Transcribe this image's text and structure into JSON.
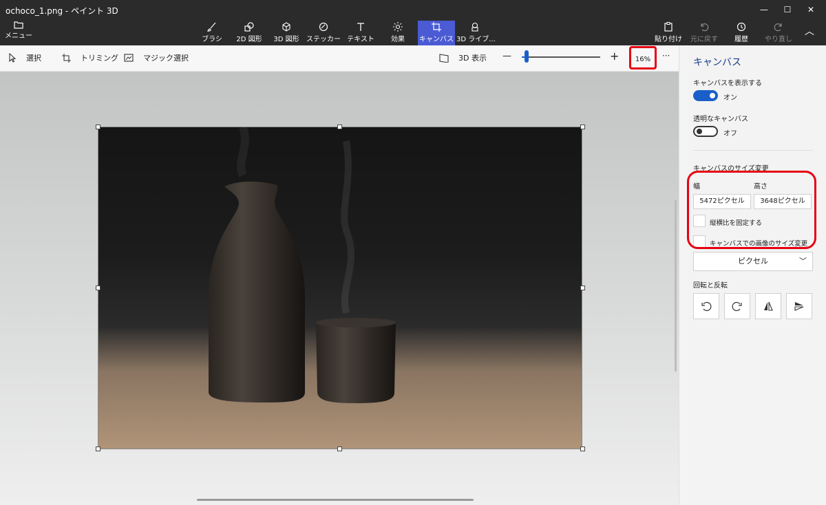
{
  "window": {
    "title": "ochoco_1.png - ペイント 3D"
  },
  "ribbon": {
    "menu_label": "メニュー",
    "tools": [
      {
        "label": "ブラシ"
      },
      {
        "label": "2D 図形"
      },
      {
        "label": "3D 図形"
      },
      {
        "label": "ステッカー"
      },
      {
        "label": "テキスト"
      },
      {
        "label": "効果"
      },
      {
        "label": "キャンバス"
      },
      {
        "label": "3D ライブ..."
      }
    ],
    "right_tools": [
      {
        "label": "貼り付け"
      },
      {
        "label": "元に戻す"
      },
      {
        "label": "履歴"
      },
      {
        "label": "やり直し"
      }
    ]
  },
  "toolbar": {
    "select": "選択",
    "crop": "トリミング",
    "magic_select": "マジック選択",
    "view_3d": "3D 表示",
    "zoom_percent": "16%",
    "zoom_minus": "—",
    "zoom_plus": "+",
    "more": "···"
  },
  "panel": {
    "title": "キャンバス",
    "show_canvas_label": "キャンバスを表示する",
    "show_canvas_state": "オン",
    "transparent_label": "透明なキャンバス",
    "transparent_state": "オフ",
    "resize_label": "キャンバスのサイズ変更",
    "width_label": "幅",
    "height_label": "高さ",
    "width_value": "5472ピクセル",
    "height_value": "3648ピクセル",
    "lock_aspect": "縦横比を固定する",
    "resize_image": "キャンバスでの画像のサイズ変更",
    "unit": "ピクセル",
    "rotate_label": "回転と反転"
  },
  "colors": {
    "accent": "#1a5fc9",
    "highlight": "#e60012",
    "active_tab": "#4a5bd4"
  }
}
